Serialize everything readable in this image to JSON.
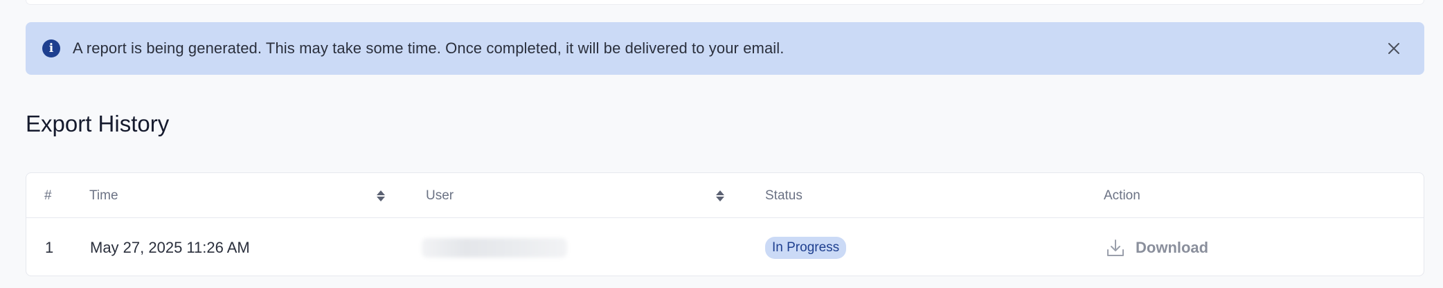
{
  "alert": {
    "message": "A report is being generated. This may take some time. Once completed, it will be delivered to your email.",
    "icon": "info-icon",
    "close_icon": "close-icon",
    "bg_color": "#cbdaf6",
    "icon_color": "#1e3f8f"
  },
  "section": {
    "title": "Export History"
  },
  "table": {
    "columns": {
      "index": "#",
      "time": "Time",
      "user": "User",
      "status": "Status",
      "action": "Action"
    },
    "rows": [
      {
        "index": "1",
        "time": "May 27, 2025 11:26 AM",
        "user": "",
        "status": "In Progress",
        "action": "Download"
      }
    ]
  }
}
